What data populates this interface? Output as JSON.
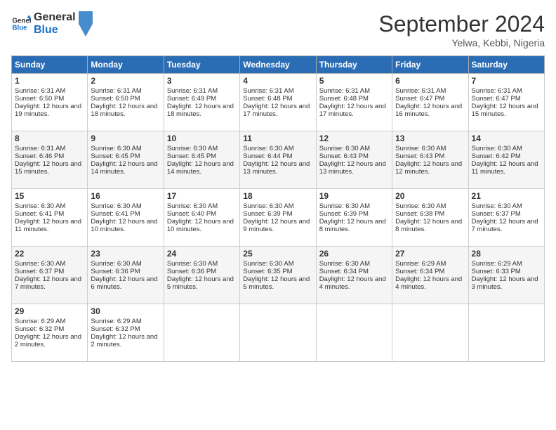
{
  "header": {
    "logo_line1": "General",
    "logo_line2": "Blue",
    "month": "September 2024",
    "location": "Yelwa, Kebbi, Nigeria"
  },
  "days_of_week": [
    "Sunday",
    "Monday",
    "Tuesday",
    "Wednesday",
    "Thursday",
    "Friday",
    "Saturday"
  ],
  "weeks": [
    [
      {
        "day": "1",
        "sunrise": "6:31 AM",
        "sunset": "6:50 PM",
        "daylight": "12 hours and 19 minutes."
      },
      {
        "day": "2",
        "sunrise": "6:31 AM",
        "sunset": "6:50 PM",
        "daylight": "12 hours and 18 minutes."
      },
      {
        "day": "3",
        "sunrise": "6:31 AM",
        "sunset": "6:49 PM",
        "daylight": "12 hours and 18 minutes."
      },
      {
        "day": "4",
        "sunrise": "6:31 AM",
        "sunset": "6:48 PM",
        "daylight": "12 hours and 17 minutes."
      },
      {
        "day": "5",
        "sunrise": "6:31 AM",
        "sunset": "6:48 PM",
        "daylight": "12 hours and 17 minutes."
      },
      {
        "day": "6",
        "sunrise": "6:31 AM",
        "sunset": "6:47 PM",
        "daylight": "12 hours and 16 minutes."
      },
      {
        "day": "7",
        "sunrise": "6:31 AM",
        "sunset": "6:47 PM",
        "daylight": "12 hours and 15 minutes."
      }
    ],
    [
      {
        "day": "8",
        "sunrise": "6:31 AM",
        "sunset": "6:46 PM",
        "daylight": "12 hours and 15 minutes."
      },
      {
        "day": "9",
        "sunrise": "6:30 AM",
        "sunset": "6:45 PM",
        "daylight": "12 hours and 14 minutes."
      },
      {
        "day": "10",
        "sunrise": "6:30 AM",
        "sunset": "6:45 PM",
        "daylight": "12 hours and 14 minutes."
      },
      {
        "day": "11",
        "sunrise": "6:30 AM",
        "sunset": "6:44 PM",
        "daylight": "12 hours and 13 minutes."
      },
      {
        "day": "12",
        "sunrise": "6:30 AM",
        "sunset": "6:43 PM",
        "daylight": "12 hours and 13 minutes."
      },
      {
        "day": "13",
        "sunrise": "6:30 AM",
        "sunset": "6:43 PM",
        "daylight": "12 hours and 12 minutes."
      },
      {
        "day": "14",
        "sunrise": "6:30 AM",
        "sunset": "6:42 PM",
        "daylight": "12 hours and 11 minutes."
      }
    ],
    [
      {
        "day": "15",
        "sunrise": "6:30 AM",
        "sunset": "6:41 PM",
        "daylight": "12 hours and 11 minutes."
      },
      {
        "day": "16",
        "sunrise": "6:30 AM",
        "sunset": "6:41 PM",
        "daylight": "12 hours and 10 minutes."
      },
      {
        "day": "17",
        "sunrise": "6:30 AM",
        "sunset": "6:40 PM",
        "daylight": "12 hours and 10 minutes."
      },
      {
        "day": "18",
        "sunrise": "6:30 AM",
        "sunset": "6:39 PM",
        "daylight": "12 hours and 9 minutes."
      },
      {
        "day": "19",
        "sunrise": "6:30 AM",
        "sunset": "6:39 PM",
        "daylight": "12 hours and 8 minutes."
      },
      {
        "day": "20",
        "sunrise": "6:30 AM",
        "sunset": "6:38 PM",
        "daylight": "12 hours and 8 minutes."
      },
      {
        "day": "21",
        "sunrise": "6:30 AM",
        "sunset": "6:37 PM",
        "daylight": "12 hours and 7 minutes."
      }
    ],
    [
      {
        "day": "22",
        "sunrise": "6:30 AM",
        "sunset": "6:37 PM",
        "daylight": "12 hours and 7 minutes."
      },
      {
        "day": "23",
        "sunrise": "6:30 AM",
        "sunset": "6:36 PM",
        "daylight": "12 hours and 6 minutes."
      },
      {
        "day": "24",
        "sunrise": "6:30 AM",
        "sunset": "6:36 PM",
        "daylight": "12 hours and 5 minutes."
      },
      {
        "day": "25",
        "sunrise": "6:30 AM",
        "sunset": "6:35 PM",
        "daylight": "12 hours and 5 minutes."
      },
      {
        "day": "26",
        "sunrise": "6:30 AM",
        "sunset": "6:34 PM",
        "daylight": "12 hours and 4 minutes."
      },
      {
        "day": "27",
        "sunrise": "6:29 AM",
        "sunset": "6:34 PM",
        "daylight": "12 hours and 4 minutes."
      },
      {
        "day": "28",
        "sunrise": "6:29 AM",
        "sunset": "6:33 PM",
        "daylight": "12 hours and 3 minutes."
      }
    ],
    [
      {
        "day": "29",
        "sunrise": "6:29 AM",
        "sunset": "6:32 PM",
        "daylight": "12 hours and 2 minutes."
      },
      {
        "day": "30",
        "sunrise": "6:29 AM",
        "sunset": "6:32 PM",
        "daylight": "12 hours and 2 minutes."
      },
      {
        "day": "",
        "sunrise": "",
        "sunset": "",
        "daylight": ""
      },
      {
        "day": "",
        "sunrise": "",
        "sunset": "",
        "daylight": ""
      },
      {
        "day": "",
        "sunrise": "",
        "sunset": "",
        "daylight": ""
      },
      {
        "day": "",
        "sunrise": "",
        "sunset": "",
        "daylight": ""
      },
      {
        "day": "",
        "sunrise": "",
        "sunset": "",
        "daylight": ""
      }
    ]
  ],
  "labels": {
    "sunrise_prefix": "Sunrise: ",
    "sunset_prefix": "Sunset: ",
    "daylight_prefix": "Daylight: "
  }
}
